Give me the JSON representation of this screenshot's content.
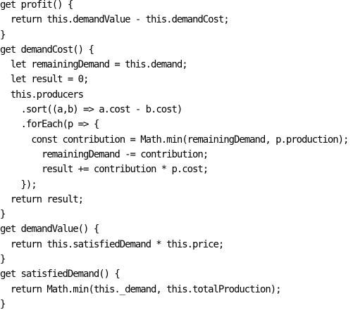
{
  "editor": {
    "lines": [
      "get profit() {",
      "  return this.demandValue - this.demandCost;",
      "}",
      "get demandCost() {",
      "  let remainingDemand = this.demand;",
      "  let result = 0;",
      "  this.producers",
      "    .sort((a,b) => a.cost - b.cost)",
      "    .forEach(p => {",
      "      const contribution = Math.min(remainingDemand, p.production);",
      "        remainingDemand -= contribution;",
      "        result += contribution * p.cost;",
      "    });",
      "  return result;",
      "}",
      "get demandValue() {",
      "  return this.satisfiedDemand * this.price;",
      "}",
      "get satisfiedDemand() {",
      "  return Math.min(this._demand, this.totalProduction);",
      "}"
    ]
  }
}
